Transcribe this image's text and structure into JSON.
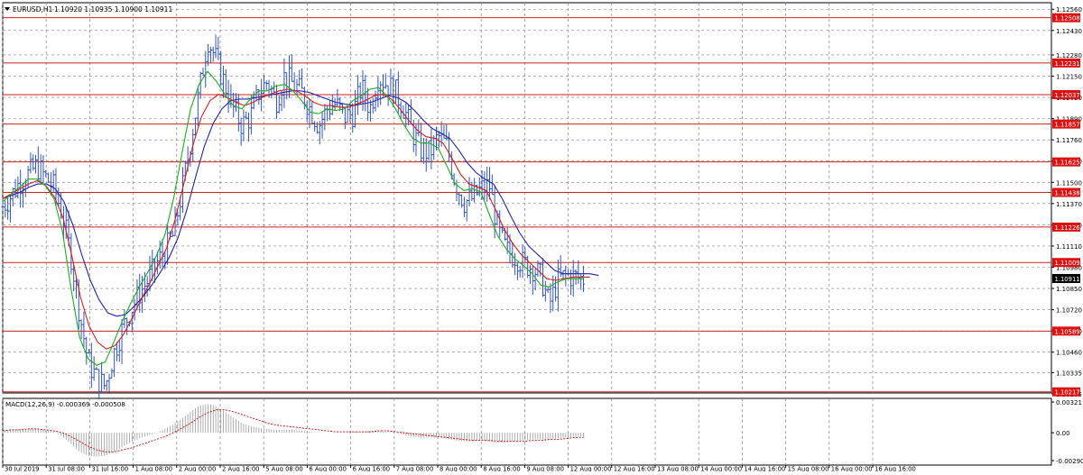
{
  "header": {
    "symbol": "EURUSD,H1",
    "ohlc": "1.10920 1.10935 1.10900 1.10911"
  },
  "macd_label": "MACD(12,26,9) -0.000369 -0.000508",
  "colors": {
    "grid": "#808080",
    "candle": "#3355bb",
    "ma_fast": "#22aa22",
    "ma_mid": "#cc2222",
    "ma_slow": "#2222aa",
    "level": "#cc2222",
    "level_badge": "#dd1111",
    "current_badge": "#000000",
    "macd_hist": "#999999",
    "macd_signal": "#cc2222"
  },
  "chart_data": {
    "type": "line",
    "title": "EURUSD,H1",
    "price_axis": {
      "ylim": [
        1.1021,
        1.126
      ],
      "ticks": [
        "1.12560",
        "1.12430",
        "1.12280",
        "1.12150",
        "1.12020",
        "1.11890",
        "1.11760",
        "1.11630",
        "1.11500",
        "1.11370",
        "1.11240",
        "1.11110",
        "1.10980",
        "1.10850",
        "1.10720",
        "1.10590",
        "1.10460",
        "1.10335",
        "1.10205"
      ]
    },
    "x_ticks": [
      "30 Jul 2019",
      "31 Jul 08:00",
      "31 Jul 16:00",
      "1 Aug 08:00",
      "2 Aug 00:00",
      "2 Aug 16:00",
      "5 Aug 08:00",
      "6 Aug 00:00",
      "6 Aug 16:00",
      "7 Aug 08:00",
      "8 Aug 00:00",
      "8 Aug 16:00",
      "9 Aug 08:00",
      "12 Aug 00:00",
      "12 Aug 16:00",
      "13 Aug 08:00",
      "14 Aug 00:00",
      "14 Aug 16:00",
      "15 Aug 08:00",
      "16 Aug 00:00",
      "16 Aug 16:00"
    ],
    "levels": [
      {
        "value": 1.12508,
        "label": "1.12508"
      },
      {
        "value": 1.12231,
        "label": "1.12231"
      },
      {
        "value": 1.12037,
        "label": "1.12037"
      },
      {
        "value": 1.11857,
        "label": "1.11857"
      },
      {
        "value": 1.11625,
        "label": "1.11625"
      },
      {
        "value": 1.11438,
        "label": "1.11438"
      },
      {
        "value": 1.11226,
        "label": "1.11226"
      },
      {
        "value": 1.11009,
        "label": "1.11009"
      },
      {
        "value": 1.10589,
        "label": "1.10589"
      },
      {
        "value": 1.10217,
        "label": "1.10217"
      }
    ],
    "current_price": {
      "value": 1.10911,
      "label": "1.10911"
    },
    "close_series": {
      "x_start": 0,
      "x_end": 13.35,
      "values": [
        1.1135,
        1.1142,
        1.115,
        1.1155,
        1.116,
        1.1153,
        1.1147,
        1.113,
        1.1105,
        1.107,
        1.104,
        1.103,
        1.1025,
        1.1045,
        1.106,
        1.1072,
        1.1082,
        1.109,
        1.11,
        1.1108,
        1.1118,
        1.1145,
        1.1175,
        1.1205,
        1.1238,
        1.1225,
        1.121,
        1.1195,
        1.1185,
        1.119,
        1.1205,
        1.1212,
        1.12,
        1.1215,
        1.121,
        1.1205,
        1.1195,
        1.1185,
        1.1195,
        1.1198,
        1.119,
        1.1192,
        1.1208,
        1.1195,
        1.1215,
        1.121,
        1.1205,
        1.1195,
        1.118,
        1.117,
        1.1168,
        1.1178,
        1.1172,
        1.115,
        1.1138,
        1.114,
        1.1146,
        1.1148,
        1.112,
        1.1108,
        1.1105,
        1.11,
        1.1098,
        1.1092,
        1.1075,
        1.109,
        1.1093,
        1.1092,
        1.1091
      ]
    },
    "ma_fast": {
      "x_start": 0,
      "x_end": 13.35,
      "values": [
        1.1138,
        1.1143,
        1.1147,
        1.1152,
        1.1152,
        1.1148,
        1.114,
        1.112,
        1.1085,
        1.1055,
        1.1042,
        1.1038,
        1.104,
        1.1052,
        1.1065,
        1.1076,
        1.1086,
        1.1095,
        1.1105,
        1.1118,
        1.114,
        1.1168,
        1.1195,
        1.121,
        1.1218,
        1.1212,
        1.1204,
        1.1197,
        1.1195,
        1.1201,
        1.1206,
        1.1206,
        1.1209,
        1.121,
        1.1206,
        1.12,
        1.1193,
        1.1192,
        1.1195,
        1.1194,
        1.1195,
        1.12,
        1.1203,
        1.1207,
        1.1208,
        1.1203,
        1.1195,
        1.1185,
        1.1177,
        1.1174,
        1.1174,
        1.1171,
        1.116,
        1.1149,
        1.1145,
        1.1146,
        1.1144,
        1.113,
        1.1117,
        1.1109,
        1.1103,
        1.1099,
        1.1094,
        1.1087,
        1.1086,
        1.1089,
        1.1091,
        1.1091,
        1.1091
      ]
    },
    "ma_mid": {
      "x_start": 0,
      "x_end": 13.5,
      "values": [
        1.114,
        1.1143,
        1.1146,
        1.1149,
        1.1151,
        1.1148,
        1.1141,
        1.1128,
        1.1105,
        1.108,
        1.1062,
        1.1052,
        1.1048,
        1.105,
        1.1057,
        1.1067,
        1.1078,
        1.1088,
        1.1099,
        1.111,
        1.1128,
        1.115,
        1.1172,
        1.119,
        1.12,
        1.1204,
        1.1202,
        1.1199,
        1.1197,
        1.1199,
        1.1202,
        1.1204,
        1.1206,
        1.1207,
        1.1206,
        1.1203,
        1.1199,
        1.1197,
        1.1197,
        1.1196,
        1.1196,
        1.1198,
        1.12,
        1.1203,
        1.1204,
        1.1201,
        1.1195,
        1.1188,
        1.1182,
        1.1178,
        1.1177,
        1.1174,
        1.1165,
        1.1155,
        1.1149,
        1.1147,
        1.1145,
        1.1134,
        1.1122,
        1.1113,
        1.1106,
        1.1101,
        1.1096,
        1.1091,
        1.109,
        1.1091,
        1.1092,
        1.1092,
        1.1092
      ]
    },
    "ma_slow": {
      "x_start": 0,
      "x_end": 13.7,
      "values": [
        1.114,
        1.1142,
        1.1144,
        1.1147,
        1.1149,
        1.1149,
        1.1146,
        1.1138,
        1.1124,
        1.1106,
        1.109,
        1.1078,
        1.107,
        1.1068,
        1.1069,
        1.1074,
        1.108,
        1.1087,
        1.1095,
        1.1104,
        1.1116,
        1.1133,
        1.1153,
        1.1172,
        1.1186,
        1.1195,
        1.12,
        1.1201,
        1.1201,
        1.1202,
        1.1203,
        1.1204,
        1.1205,
        1.1206,
        1.1206,
        1.1205,
        1.1203,
        1.1201,
        1.1199,
        1.1198,
        1.1197,
        1.1198,
        1.1199,
        1.1201,
        1.1203,
        1.1202,
        1.1199,
        1.1194,
        1.1188,
        1.1183,
        1.118,
        1.1177,
        1.117,
        1.1162,
        1.1156,
        1.1152,
        1.1149,
        1.114,
        1.1129,
        1.1119,
        1.1111,
        1.1106,
        1.1101,
        1.1096,
        1.1094,
        1.1094,
        1.1094,
        1.1094,
        1.1093
      ]
    },
    "macd": {
      "ylim": [
        -0.003,
        0.00321
      ],
      "ticks": [
        "0.00321",
        "0.00",
        "-0.002908"
      ],
      "x_start": 0,
      "x_end": 13.35,
      "histogram": [
        0.0002,
        0.0003,
        0.0004,
        0.0004,
        0.0004,
        0.0003,
        0.0001,
        -0.0004,
        -0.0012,
        -0.002,
        -0.0024,
        -0.0025,
        -0.0024,
        -0.002,
        -0.0015,
        -0.001,
        -0.0006,
        -0.0003,
        0.0,
        0.0004,
        0.0009,
        0.0015,
        0.0022,
        0.0028,
        0.003,
        0.0028,
        0.0022,
        0.0016,
        0.001,
        0.0007,
        0.0005,
        0.0004,
        0.0003,
        0.0003,
        0.0003,
        0.0002,
        0.0001,
        0.0,
        0.0,
        0.0,
        0.0,
        0.0001,
        0.0001,
        0.0002,
        0.0002,
        0.0001,
        0.0,
        -0.0002,
        -0.0004,
        -0.0005,
        -0.0005,
        -0.0005,
        -0.0006,
        -0.0008,
        -0.0009,
        -0.0009,
        -0.0008,
        -0.0009,
        -0.001,
        -0.001,
        -0.0009,
        -0.0008,
        -0.0007,
        -0.0007,
        -0.0007,
        -0.0006,
        -0.0005,
        -0.0004,
        -0.0004
      ],
      "signal": [
        0.0002,
        0.0003,
        0.0003,
        0.0004,
        0.0004,
        0.0003,
        0.0002,
        0.0,
        -0.0004,
        -0.0009,
        -0.0014,
        -0.0018,
        -0.002,
        -0.002,
        -0.0018,
        -0.0016,
        -0.0013,
        -0.001,
        -0.0007,
        -0.0004,
        0.0,
        0.0005,
        0.001,
        0.0016,
        0.0021,
        0.0024,
        0.0024,
        0.0022,
        0.0019,
        0.0016,
        0.0013,
        0.001,
        0.0008,
        0.0007,
        0.0006,
        0.0005,
        0.0004,
        0.0003,
        0.0002,
        0.0001,
        0.0001,
        0.0001,
        0.0001,
        0.0001,
        0.0002,
        0.0002,
        0.0001,
        0.0,
        -0.0001,
        -0.0002,
        -0.0003,
        -0.0004,
        -0.0005,
        -0.0006,
        -0.0007,
        -0.0008,
        -0.0008,
        -0.0008,
        -0.0009,
        -0.0009,
        -0.0009,
        -0.0009,
        -0.0008,
        -0.0008,
        -0.0007,
        -0.0007,
        -0.0006,
        -0.0005,
        -0.0005
      ]
    }
  }
}
